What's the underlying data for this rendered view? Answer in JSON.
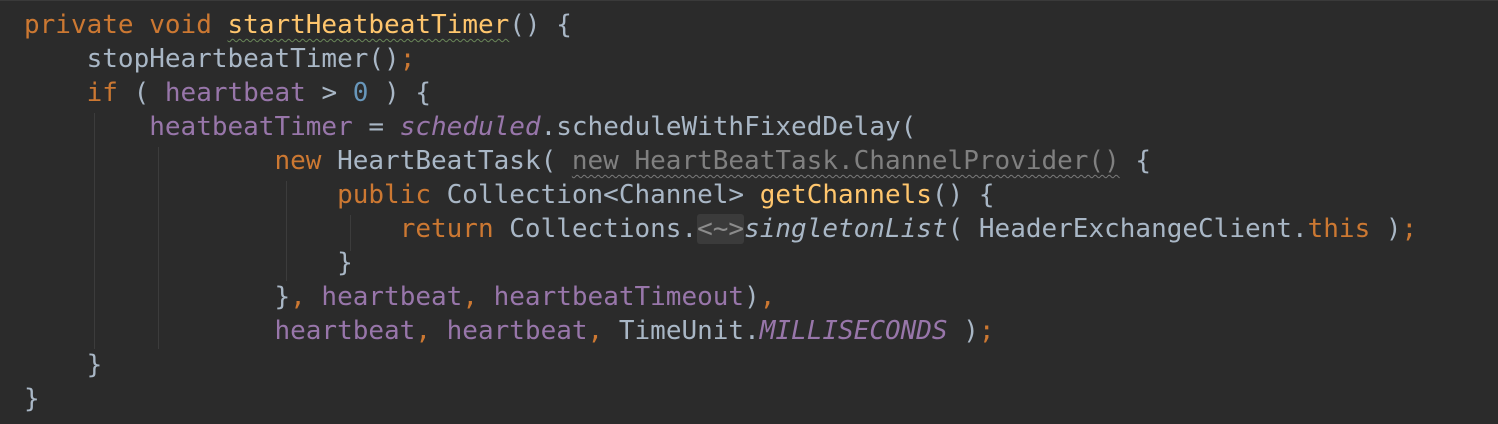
{
  "editor": {
    "lines": [
      {
        "id": "l1",
        "tokens": [
          {
            "t": "private",
            "c": "kw"
          },
          {
            "t": " ",
            "c": "pun"
          },
          {
            "t": "void",
            "c": "kw"
          },
          {
            "t": " ",
            "c": "pun"
          },
          {
            "t": "startHeatbeatTimer",
            "c": "fn squig"
          },
          {
            "t": "() {",
            "c": "pun"
          }
        ]
      },
      {
        "id": "l2",
        "tokens": [
          {
            "t": "    stopHeartbeatTimer()",
            "c": "pun"
          },
          {
            "t": ";",
            "c": "semi"
          }
        ]
      },
      {
        "id": "l3",
        "tokens": [
          {
            "t": "    ",
            "c": "pun"
          },
          {
            "t": "if",
            "c": "kw"
          },
          {
            "t": " ( ",
            "c": "pun"
          },
          {
            "t": "heartbeat",
            "c": "fld"
          },
          {
            "t": " > ",
            "c": "pun"
          },
          {
            "t": "0",
            "c": "num"
          },
          {
            "t": " ) {",
            "c": "pun"
          }
        ]
      },
      {
        "id": "l4",
        "tokens": [
          {
            "t": "        ",
            "c": "pun"
          },
          {
            "t": "heatbeatTimer",
            "c": "fld"
          },
          {
            "t": " = ",
            "c": "pun"
          },
          {
            "t": "scheduled",
            "c": "stat"
          },
          {
            "t": ".scheduleWithFixedDelay(",
            "c": "pun"
          }
        ]
      },
      {
        "id": "l5",
        "tokens": [
          {
            "t": "                ",
            "c": "pun"
          },
          {
            "t": "new",
            "c": "kw"
          },
          {
            "t": " HeartBeatTask( ",
            "c": "pun"
          },
          {
            "t": "new HeartBeatTask.ChannelProvider()",
            "c": "hint squig-grey"
          },
          {
            "t": " {",
            "c": "pun"
          }
        ]
      },
      {
        "id": "l6",
        "tokens": [
          {
            "t": "                    ",
            "c": "pun"
          },
          {
            "t": "public",
            "c": "kw"
          },
          {
            "t": " Collection<Channel> ",
            "c": "pun"
          },
          {
            "t": "getChannels",
            "c": "fn"
          },
          {
            "t": "() {",
            "c": "pun"
          }
        ]
      },
      {
        "id": "l7",
        "tokens": [
          {
            "t": "                        ",
            "c": "pun"
          },
          {
            "t": "return",
            "c": "kw"
          },
          {
            "t": " Collections.",
            "c": "pun"
          },
          {
            "t": "<~>",
            "c": "fold-hint"
          },
          {
            "t": "singletonList",
            "c": "ital"
          },
          {
            "t": "( HeaderExchangeClient.",
            "c": "pun"
          },
          {
            "t": "this",
            "c": "kw"
          },
          {
            "t": " )",
            "c": "pun"
          },
          {
            "t": ";",
            "c": "semi"
          }
        ]
      },
      {
        "id": "l8",
        "tokens": [
          {
            "t": "                    }",
            "c": "pun"
          }
        ]
      },
      {
        "id": "l9",
        "tokens": [
          {
            "t": "                }",
            "c": "pun"
          },
          {
            "t": ", ",
            "c": "semi"
          },
          {
            "t": "heartbeat",
            "c": "fld"
          },
          {
            "t": ", ",
            "c": "semi"
          },
          {
            "t": "heartbeatTimeout",
            "c": "fld"
          },
          {
            "t": ")",
            "c": "pun"
          },
          {
            "t": ",",
            "c": "semi"
          }
        ]
      },
      {
        "id": "l10",
        "tokens": [
          {
            "t": "                ",
            "c": "pun"
          },
          {
            "t": "heartbeat",
            "c": "fld"
          },
          {
            "t": ", ",
            "c": "semi"
          },
          {
            "t": "heartbeat",
            "c": "fld"
          },
          {
            "t": ", ",
            "c": "semi"
          },
          {
            "t": "TimeUnit.",
            "c": "pun"
          },
          {
            "t": "MILLISECONDS",
            "c": "stat"
          },
          {
            "t": " )",
            "c": "pun"
          },
          {
            "t": ";",
            "c": "semi"
          }
        ]
      },
      {
        "id": "l11",
        "tokens": [
          {
            "t": "    }",
            "c": "pun"
          }
        ]
      },
      {
        "id": "l12",
        "tokens": [
          {
            "t": "}",
            "c": "pun"
          }
        ]
      }
    ]
  }
}
